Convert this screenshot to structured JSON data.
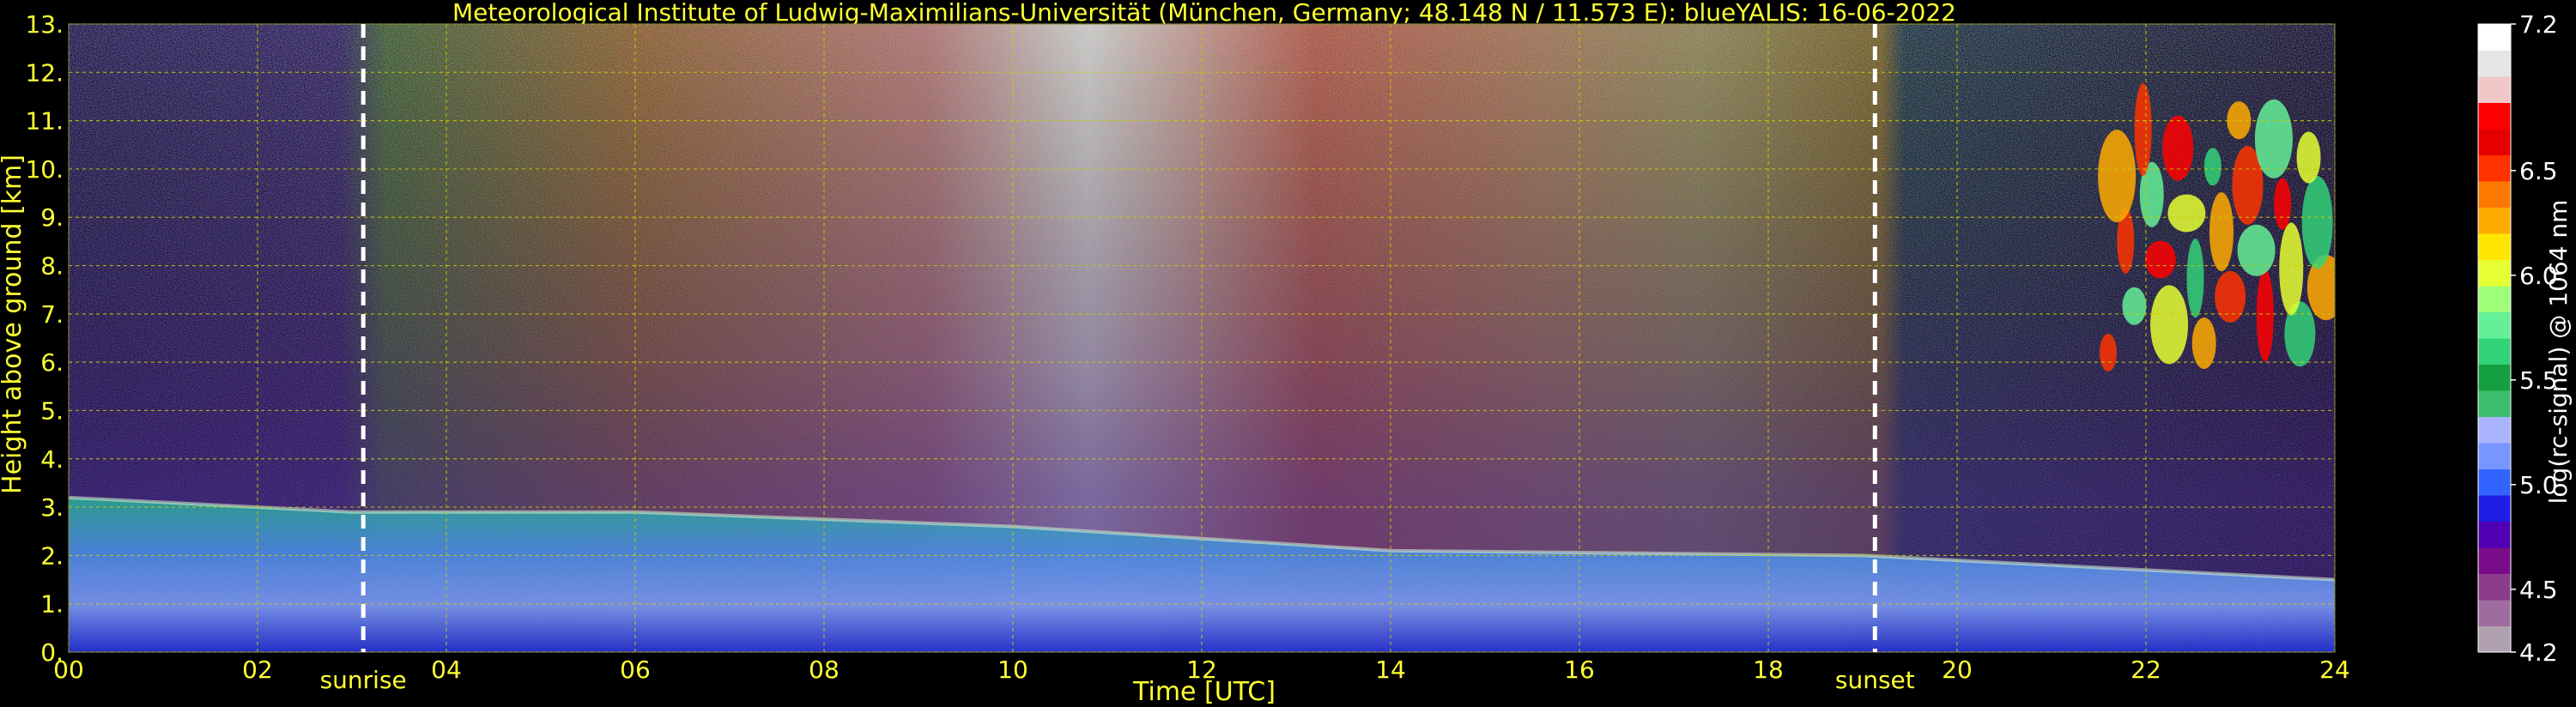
{
  "chart_data": {
    "type": "heatmap",
    "title": "Meteorological Institute of Ludwig-Maximilians-Universität (München, Germany; 48.148 N / 11.573 E):     blueYALIS: 16-06-2022",
    "xlabel": "Time [UTC]",
    "ylabel": "Height above ground [km]",
    "xlim": [
      0,
      24
    ],
    "ylim": [
      0,
      13
    ],
    "x_ticks": [
      "00",
      "02",
      "04",
      "06",
      "08",
      "10",
      "12",
      "14",
      "16",
      "18",
      "20",
      "22",
      "24"
    ],
    "y_ticks": [
      "0.",
      "1.",
      "2.",
      "3.",
      "4.",
      "5.",
      "6.",
      "7.",
      "8.",
      "9.",
      "10.",
      "11.",
      "12.",
      "13."
    ],
    "grid": true,
    "colorbar": {
      "label": "log(rc-signal) @ 1064 nm",
      "range": [
        4.2,
        7.2
      ],
      "ticks": [
        "4.2",
        "4.5",
        "5.0",
        "5.5",
        "6.0",
        "6.5",
        "7.2"
      ],
      "tick_values": [
        4.2,
        4.5,
        5.0,
        5.5,
        6.0,
        6.5,
        7.2
      ],
      "colors": [
        "#b0a0b0",
        "#a06ca0",
        "#8c3c8c",
        "#7a0c8a",
        "#5000b4",
        "#1e1ee6",
        "#3264ff",
        "#7896ff",
        "#aab4ff",
        "#3cbe6e",
        "#14a040",
        "#32d278",
        "#64f096",
        "#a0ff78",
        "#e6ff32",
        "#ffe600",
        "#ffaa00",
        "#ff7800",
        "#ff3200",
        "#e60000",
        "#ff0000",
        "#f0c8c8",
        "#e6e6e6",
        "#ffffff"
      ]
    },
    "annotations": [
      {
        "text": "sunrise",
        "x": 3.12
      },
      {
        "text": "sunset",
        "x": 19.13
      }
    ],
    "layers": [
      {
        "kind": "boundary_layer",
        "x": [
          0,
          3,
          6,
          10,
          14,
          19,
          24
        ],
        "top_km": [
          3.2,
          2.9,
          2.9,
          2.6,
          2.1,
          2.0,
          1.5
        ]
      },
      {
        "kind": "cirrus",
        "x_range": [
          21.6,
          24
        ],
        "height_km": [
          6.2,
          11.2
        ]
      }
    ]
  },
  "colors": {
    "background": "#000000",
    "text": "#ffff33",
    "grid": "#cccc00",
    "marker_line": "#ffffff"
  }
}
